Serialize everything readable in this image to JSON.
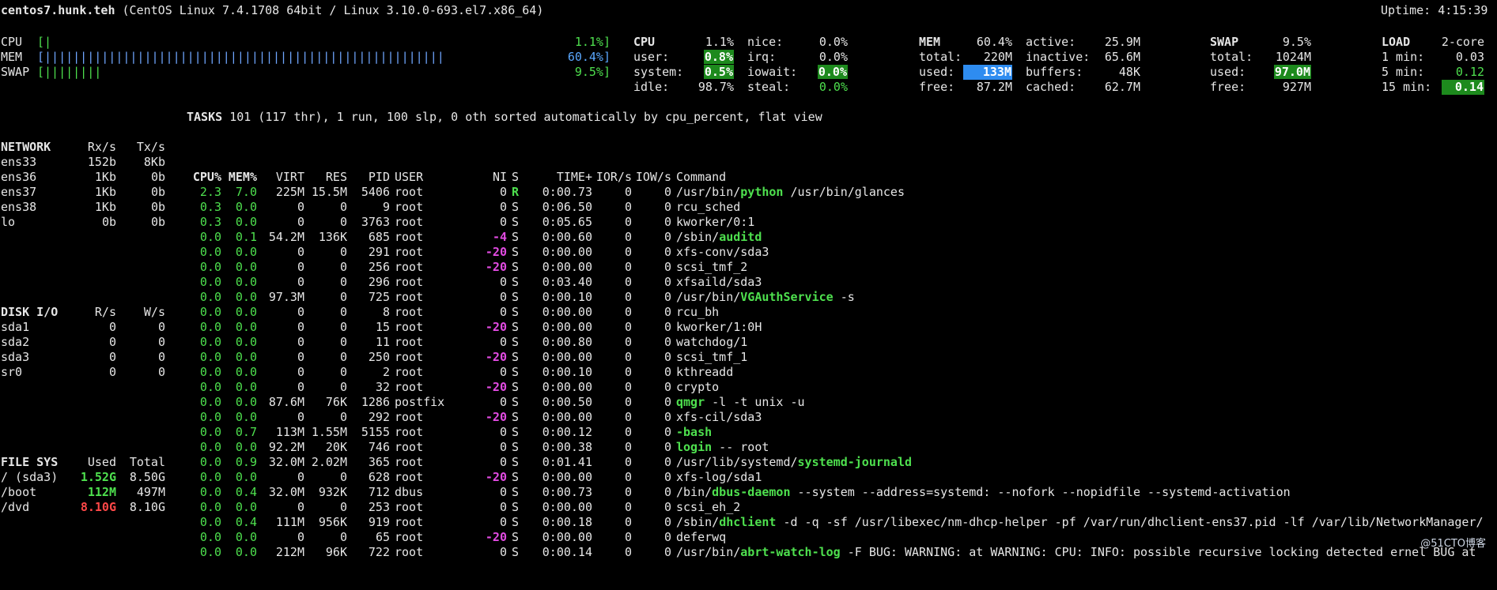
{
  "header": {
    "host": "centos7.hunk.teh",
    "os": "(CentOS Linux 7.4.1708 64bit / Linux 3.10.0-693.el7.x86_64)",
    "uptime": "Uptime: 4:15:39"
  },
  "quicklook": {
    "cpu": {
      "label": "CPU",
      "bar": "[|",
      "value": "1.1%]"
    },
    "mem": {
      "label": "MEM",
      "bar": "[||||||||||||||||||||||||||||||||||||||||||||||||||||||||",
      "value": "60.4%]"
    },
    "swap": {
      "label": "SWAP",
      "bar": "[||||||||",
      "value": "9.5%]"
    }
  },
  "cpu": {
    "title": "CPU",
    "total": "1.1%",
    "user_l": "user:",
    "user": "0.8%",
    "system_l": "system:",
    "system": "0.5%",
    "idle_l": "idle:",
    "idle": "98.7%",
    "nice_l": "nice:",
    "nice": "0.0%",
    "irq_l": "irq:",
    "irq": "0.0%",
    "iowait_l": "iowait:",
    "iowait": "0.0%",
    "steal_l": "steal:",
    "steal": "0.0%"
  },
  "mem": {
    "title": "MEM",
    "pct": "60.4%",
    "total_l": "total:",
    "total": "220M",
    "used_l": "used:",
    "used": "133M",
    "free_l": "free:",
    "free": "87.2M",
    "active_l": "active:",
    "active": "25.9M",
    "inactive_l": "inactive:",
    "inactive": "65.6M",
    "buffers_l": "buffers:",
    "buffers": "48K",
    "cached_l": "cached:",
    "cached": "62.7M"
  },
  "swap": {
    "title": "SWAP",
    "pct": "9.5%",
    "total_l": "total:",
    "total": "1024M",
    "used_l": "used:",
    "used": "97.0M",
    "free_l": "free:",
    "free": "927M"
  },
  "load": {
    "title": "LOAD",
    "cores": "2-core",
    "m1_l": "1 min:",
    "m1": "0.03",
    "m5_l": "5 min:",
    "m5": "0.12",
    "m15_l": "15 min:",
    "m15": "0.14"
  },
  "network": {
    "headers": [
      "NETWORK",
      "Rx/s",
      "Tx/s"
    ],
    "rows": [
      [
        "ens33",
        "152b",
        "8Kb"
      ],
      [
        "ens36",
        "1Kb",
        "0b"
      ],
      [
        "ens37",
        "1Kb",
        "0b"
      ],
      [
        "ens38",
        "1Kb",
        "0b"
      ],
      [
        "lo",
        "0b",
        "0b"
      ]
    ]
  },
  "diskio": {
    "headers": [
      "DISK I/O",
      "R/s",
      "W/s"
    ],
    "rows": [
      [
        "sda1",
        "0",
        "0"
      ],
      [
        "sda2",
        "0",
        "0"
      ],
      [
        "sda3",
        "0",
        "0"
      ],
      [
        "sr0",
        "0",
        "0"
      ]
    ]
  },
  "fs": {
    "headers": [
      "FILE SYS",
      "Used",
      "Total"
    ],
    "rows": [
      {
        "name": "/ (sda3)",
        "used": "1.52G",
        "total": "8.50G",
        "lvl": "g"
      },
      {
        "name": "/boot",
        "used": "112M",
        "total": "497M",
        "lvl": "g"
      },
      {
        "name": "/dvd",
        "used": "8.10G",
        "total": "8.10G",
        "lvl": "r"
      }
    ]
  },
  "tasks": {
    "label": "TASKS",
    "summary": "101 (117 thr), 1 run, 100 slp, 0 oth sorted automatically by cpu_percent, flat view"
  },
  "proc": {
    "headers": [
      "CPU%",
      "MEM%",
      "VIRT",
      "RES",
      "PID",
      "USER",
      "NI",
      "S",
      "TIME+",
      "IOR/s",
      "IOW/s",
      "Command"
    ],
    "rows": [
      [
        "2.3",
        "7.0",
        "225M",
        "15.5M",
        "5406",
        "root",
        "0",
        "R",
        "0:00.73",
        "0",
        "0",
        "/usr/bin/",
        "python",
        " /usr/bin/glances"
      ],
      [
        "0.3",
        "0.0",
        "0",
        "0",
        "9",
        "root",
        "0",
        "S",
        "0:06.50",
        "0",
        "0",
        "rcu_sched",
        "",
        ""
      ],
      [
        "0.3",
        "0.0",
        "0",
        "0",
        "3763",
        "root",
        "0",
        "S",
        "0:05.65",
        "0",
        "0",
        "kworker/0:1",
        "",
        ""
      ],
      [
        "0.0",
        "0.1",
        "54.2M",
        "136K",
        "685",
        "root",
        "-4",
        "S",
        "0:00.60",
        "0",
        "0",
        "/sbin/",
        "auditd",
        ""
      ],
      [
        "0.0",
        "0.0",
        "0",
        "0",
        "291",
        "root",
        "-20",
        "S",
        "0:00.00",
        "0",
        "0",
        "xfs-conv/sda3",
        "",
        ""
      ],
      [
        "0.0",
        "0.0",
        "0",
        "0",
        "256",
        "root",
        "-20",
        "S",
        "0:00.00",
        "0",
        "0",
        "scsi_tmf_2",
        "",
        ""
      ],
      [
        "0.0",
        "0.0",
        "0",
        "0",
        "296",
        "root",
        "0",
        "S",
        "0:03.40",
        "0",
        "0",
        "xfsaild/sda3",
        "",
        ""
      ],
      [
        "0.0",
        "0.0",
        "97.3M",
        "0",
        "725",
        "root",
        "0",
        "S",
        "0:00.10",
        "0",
        "0",
        "/usr/bin/",
        "VGAuthService",
        " -s"
      ],
      [
        "0.0",
        "0.0",
        "0",
        "0",
        "8",
        "root",
        "0",
        "S",
        "0:00.00",
        "0",
        "0",
        "rcu_bh",
        "",
        ""
      ],
      [
        "0.0",
        "0.0",
        "0",
        "0",
        "15",
        "root",
        "-20",
        "S",
        "0:00.00",
        "0",
        "0",
        "kworker/1:0H",
        "",
        ""
      ],
      [
        "0.0",
        "0.0",
        "0",
        "0",
        "11",
        "root",
        "0",
        "S",
        "0:00.80",
        "0",
        "0",
        "watchdog/1",
        "",
        ""
      ],
      [
        "0.0",
        "0.0",
        "0",
        "0",
        "250",
        "root",
        "-20",
        "S",
        "0:00.00",
        "0",
        "0",
        "scsi_tmf_1",
        "",
        ""
      ],
      [
        "0.0",
        "0.0",
        "0",
        "0",
        "2",
        "root",
        "0",
        "S",
        "0:00.10",
        "0",
        "0",
        "kthreadd",
        "",
        ""
      ],
      [
        "0.0",
        "0.0",
        "0",
        "0",
        "32",
        "root",
        "-20",
        "S",
        "0:00.00",
        "0",
        "0",
        "crypto",
        "",
        ""
      ],
      [
        "0.0",
        "0.0",
        "87.6M",
        "76K",
        "1286",
        "postfix",
        "0",
        "S",
        "0:00.50",
        "0",
        "0",
        "",
        "qmgr",
        " -l -t unix -u"
      ],
      [
        "0.0",
        "0.0",
        "0",
        "0",
        "292",
        "root",
        "-20",
        "S",
        "0:00.00",
        "0",
        "0",
        "xfs-cil/sda3",
        "",
        ""
      ],
      [
        "0.0",
        "0.7",
        "113M",
        "1.55M",
        "5155",
        "root",
        "0",
        "S",
        "0:00.12",
        "0",
        "0",
        "",
        "-bash",
        ""
      ],
      [
        "0.0",
        "0.0",
        "92.2M",
        "20K",
        "746",
        "root",
        "0",
        "S",
        "0:00.38",
        "0",
        "0",
        "",
        "login",
        " -- root"
      ],
      [
        "0.0",
        "0.9",
        "32.0M",
        "2.02M",
        "365",
        "root",
        "0",
        "S",
        "0:01.41",
        "0",
        "0",
        "/usr/lib/systemd/",
        "systemd-journald",
        ""
      ],
      [
        "0.0",
        "0.0",
        "0",
        "0",
        "628",
        "root",
        "-20",
        "S",
        "0:00.00",
        "0",
        "0",
        "xfs-log/sda1",
        "",
        ""
      ],
      [
        "0.0",
        "0.4",
        "32.0M",
        "932K",
        "712",
        "dbus",
        "0",
        "S",
        "0:00.73",
        "0",
        "0",
        "/bin/",
        "dbus-daemon",
        " --system --address=systemd: --nofork --nopidfile --systemd-activation"
      ],
      [
        "0.0",
        "0.0",
        "0",
        "0",
        "253",
        "root",
        "0",
        "S",
        "0:00.00",
        "0",
        "0",
        "scsi_eh_2",
        "",
        ""
      ],
      [
        "0.0",
        "0.4",
        "111M",
        "956K",
        "919",
        "root",
        "0",
        "S",
        "0:00.18",
        "0",
        "0",
        "/sbin/",
        "dhclient",
        " -d -q -sf /usr/libexec/nm-dhcp-helper -pf /var/run/dhclient-ens37.pid -lf /var/lib/NetworkManager/"
      ],
      [
        "0.0",
        "0.0",
        "0",
        "0",
        "65",
        "root",
        "-20",
        "S",
        "0:00.00",
        "0",
        "0",
        "deferwq",
        "",
        ""
      ],
      [
        "0.0",
        "0.0",
        "212M",
        "96K",
        "722",
        "root",
        "0",
        "S",
        "0:00.14",
        "0",
        "0",
        "/usr/bin/",
        "abrt-watch-log",
        " -F BUG: WARNING: at WARNING: CPU: INFO: possible recursive locking detected ernel BUG at"
      ]
    ]
  },
  "watermark": "@51CTO博客"
}
